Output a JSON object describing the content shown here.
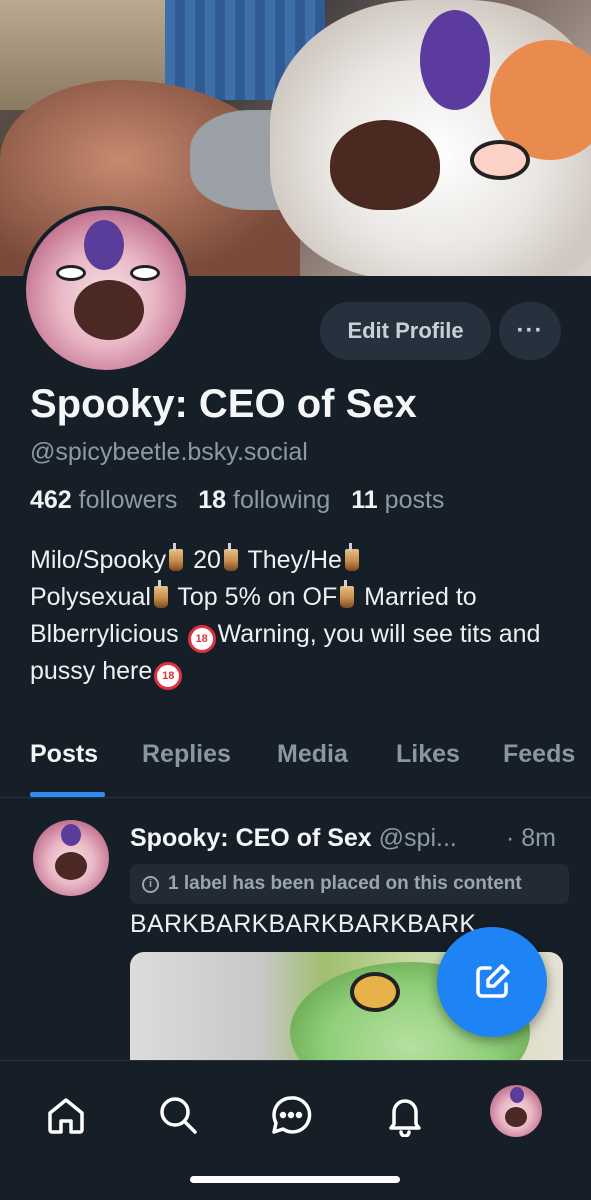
{
  "profile": {
    "display_name": "Spooky: CEO of Sex",
    "handle": "@spicybeetle.bsky.social",
    "followers_count": "462",
    "followers_label": "followers",
    "following_count": "18",
    "following_label": "following",
    "posts_count": "11",
    "posts_label": "posts",
    "bio": {
      "seg1": "Milo/Spooky",
      "seg2": "20",
      "seg3": "They/He",
      "seg4": "Polysexual",
      "seg5": "Top 5% on OF",
      "seg6": "Married to Blberrylicious",
      "seg7": "Warning, you will see tits and pussy here",
      "emoji_boba": "bubble-tea-emoji",
      "emoji_18": "no-one-under-18-emoji"
    }
  },
  "header": {
    "edit_profile_label": "Edit Profile",
    "more_label": "···"
  },
  "tabs": [
    {
      "label": "Posts",
      "active": true
    },
    {
      "label": "Replies",
      "active": false
    },
    {
      "label": "Media",
      "active": false
    },
    {
      "label": "Likes",
      "active": false
    },
    {
      "label": "Feeds",
      "active": false
    }
  ],
  "post": {
    "author_name": "Spooky: CEO of Sex",
    "author_handle": "@spi...",
    "time_sep": "·",
    "time": "8m",
    "label_notice": "1 label has been placed on this content",
    "text": "BARKBARKBARKBARKBARK"
  },
  "nav": {
    "items": [
      "home-icon",
      "search-icon",
      "chat-icon",
      "bell-icon",
      "profile-avatar"
    ]
  },
  "colors": {
    "background": "#161e27",
    "accent": "#1e83f4",
    "muted_text": "#8d99a6",
    "button_bg": "#27313d"
  }
}
